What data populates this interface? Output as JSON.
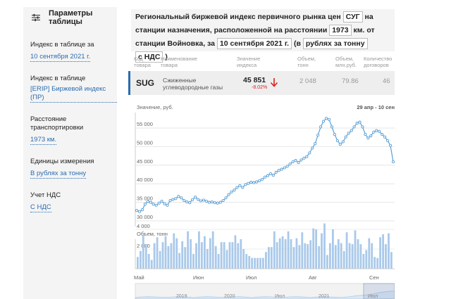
{
  "sidebar": {
    "title": "Параметры таблицы",
    "sections": [
      {
        "label": "Индекс в таблице за",
        "value": "10 сентября 2021 г."
      },
      {
        "label": "Индекс в таблице",
        "value": "[ERIP] Биржевой индекс (ПР)"
      },
      {
        "label": "Расстояние транспортировки",
        "value": "1973 км."
      },
      {
        "label": "Единицы измерения",
        "value": "В рублях за тонну"
      },
      {
        "label": "Учет НДС",
        "value": "С НДС"
      }
    ]
  },
  "title": {
    "part1": "Региональный биржевой индекс первичного рынка цен",
    "chip1": "СУГ",
    "part2": "на станции назначения, расположенной на расстоянии",
    "chip2": "1973",
    "part3": "км. от станции Войновка, за",
    "chip3": "10 сентября 2021 г.",
    "part4": "(в",
    "chip4": "рублях за тонну",
    "chip5": "с НДС",
    "part5": ")"
  },
  "table": {
    "headers": [
      "Код товара",
      "Наименование товара",
      "Значение индекса",
      "Объем, тонн",
      "Объем, млн.руб.",
      "Количество договоров"
    ],
    "row": {
      "code": "SUG",
      "name": "Сжиженные углеводородные газы",
      "value": "45 851",
      "change": "-8.02%",
      "volume_t": "2 048",
      "volume_rub": "79.86",
      "contracts": "46"
    }
  },
  "chart": {
    "price_title": "Значение, руб.",
    "date_range": "29 апр - 10 сен",
    "volume_title": "Объем, тонн",
    "month_labels": [
      "Май",
      "Июн",
      "Июл",
      "Авг",
      "Сен"
    ],
    "nav_year_labels": [
      "2019",
      "2020",
      "Июл",
      "2021",
      "Июл"
    ],
    "colors": {
      "line": "#5aa0d6",
      "bar": "#a9c9ea",
      "accent": "#2b6cb0",
      "down": "#d22222"
    }
  },
  "chart_data": [
    {
      "type": "line",
      "ylim": [
        30000,
        60000
      ],
      "y_ticks": [
        "30 000",
        "35 000",
        "40 000",
        "45 000",
        "50 000",
        "55 000"
      ],
      "values": [
        32800,
        32500,
        33000,
        34500,
        35200,
        35000,
        34500,
        34200,
        34800,
        35300,
        34600,
        34200,
        35500,
        35800,
        36000,
        36600,
        36200,
        35500,
        35100,
        34900,
        35700,
        36400,
        35800,
        35400,
        35600,
        35300,
        35000,
        35100,
        34900,
        34800,
        35000,
        35500,
        36200,
        37100,
        37800,
        38300,
        39000,
        39500,
        39000,
        39800,
        40100,
        40400,
        40300,
        40500,
        40800,
        41200,
        41800,
        42200,
        42700,
        42300,
        43100,
        43600,
        43900,
        44300,
        44700,
        45300,
        45900,
        46300,
        45700,
        46400,
        46900,
        47300,
        48300,
        49600,
        50800,
        53100,
        55300,
        56800,
        57600,
        57300,
        55300,
        53300,
        51600,
        50600,
        51300,
        52600,
        53600,
        54300,
        55300,
        56300,
        56600,
        55300,
        53300,
        52300,
        52900,
        53900,
        54300,
        54100,
        53300,
        52600,
        51600,
        50300,
        45900
      ]
    },
    {
      "type": "bar",
      "ylim": [
        0,
        6000
      ],
      "y_ticks": [
        "2 000",
        "4 000"
      ],
      "values": [
        1200,
        1800,
        3500,
        2500,
        1500,
        900,
        2600,
        3200,
        1800,
        2700,
        3300,
        2300,
        2600,
        3600,
        3100,
        1600,
        2800,
        2200,
        3800,
        3000,
        1500,
        2600,
        3800,
        2700,
        3300,
        2000,
        3100,
        3800,
        2300,
        1500,
        2700,
        2700,
        1900,
        2700,
        2700,
        3400,
        2600,
        3000,
        2000,
        1500,
        1300,
        1100,
        1100,
        1100,
        1100,
        1100,
        1700,
        2200,
        2200,
        3800,
        2700,
        3100,
        3300,
        3000,
        3800,
        3000,
        2200,
        3100,
        2400,
        3700,
        2600,
        2500,
        2900,
        4100,
        4000,
        2300,
        3600,
        4600,
        1400,
        2600,
        4000,
        2400,
        3000,
        2600,
        1800,
        3700,
        2600,
        2500,
        3900,
        3000,
        2500,
        1500,
        1900,
        3100,
        2600,
        1200,
        1100,
        3200,
        3500,
        2500,
        3600,
        1700
      ]
    }
  ]
}
